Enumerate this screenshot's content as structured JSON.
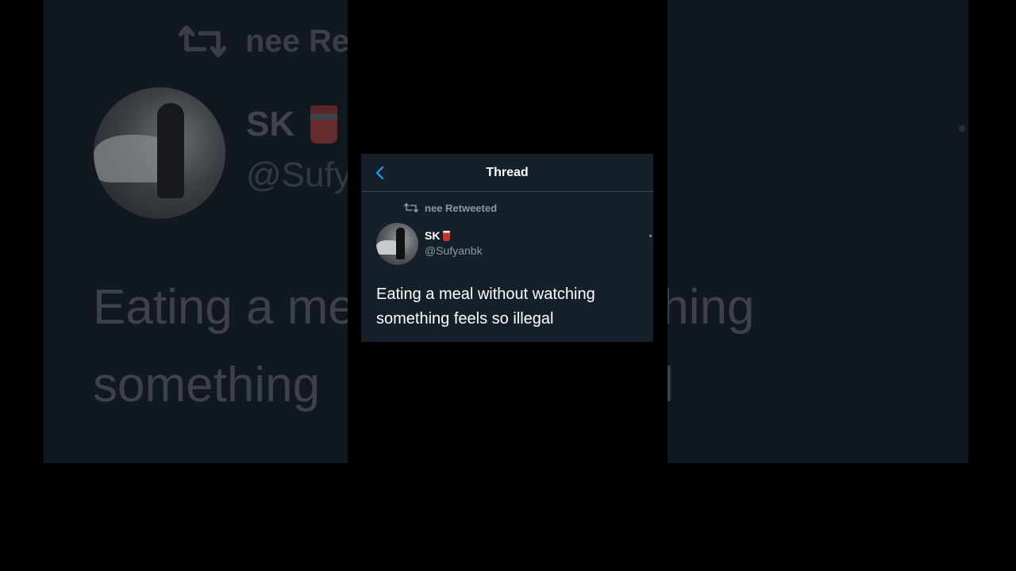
{
  "background": {
    "retweet_text": "nee Re",
    "name": "SK",
    "handle": "@Sufy",
    "tweet_line1_left": "Eating a me",
    "tweet_line1_right": "tching",
    "tweet_line2_left": "something",
    "tweet_line2_right": "l"
  },
  "header": {
    "title": "Thread",
    "back_icon": "chevron-left-icon"
  },
  "tweet": {
    "retweeted_by": "nee Retweeted",
    "retweet_icon": "retweet-icon",
    "author_name": "SK",
    "author_emoji_icon": "cup-icon",
    "author_handle": "@Sufyanbk",
    "text": "Eating a meal without watching something feels so illegal"
  },
  "colors": {
    "card_bg": "#15202b",
    "accent": "#1da1f2",
    "secondary_text": "#8899a6",
    "primary_text": "#ffffff",
    "divider": "#38444d"
  }
}
